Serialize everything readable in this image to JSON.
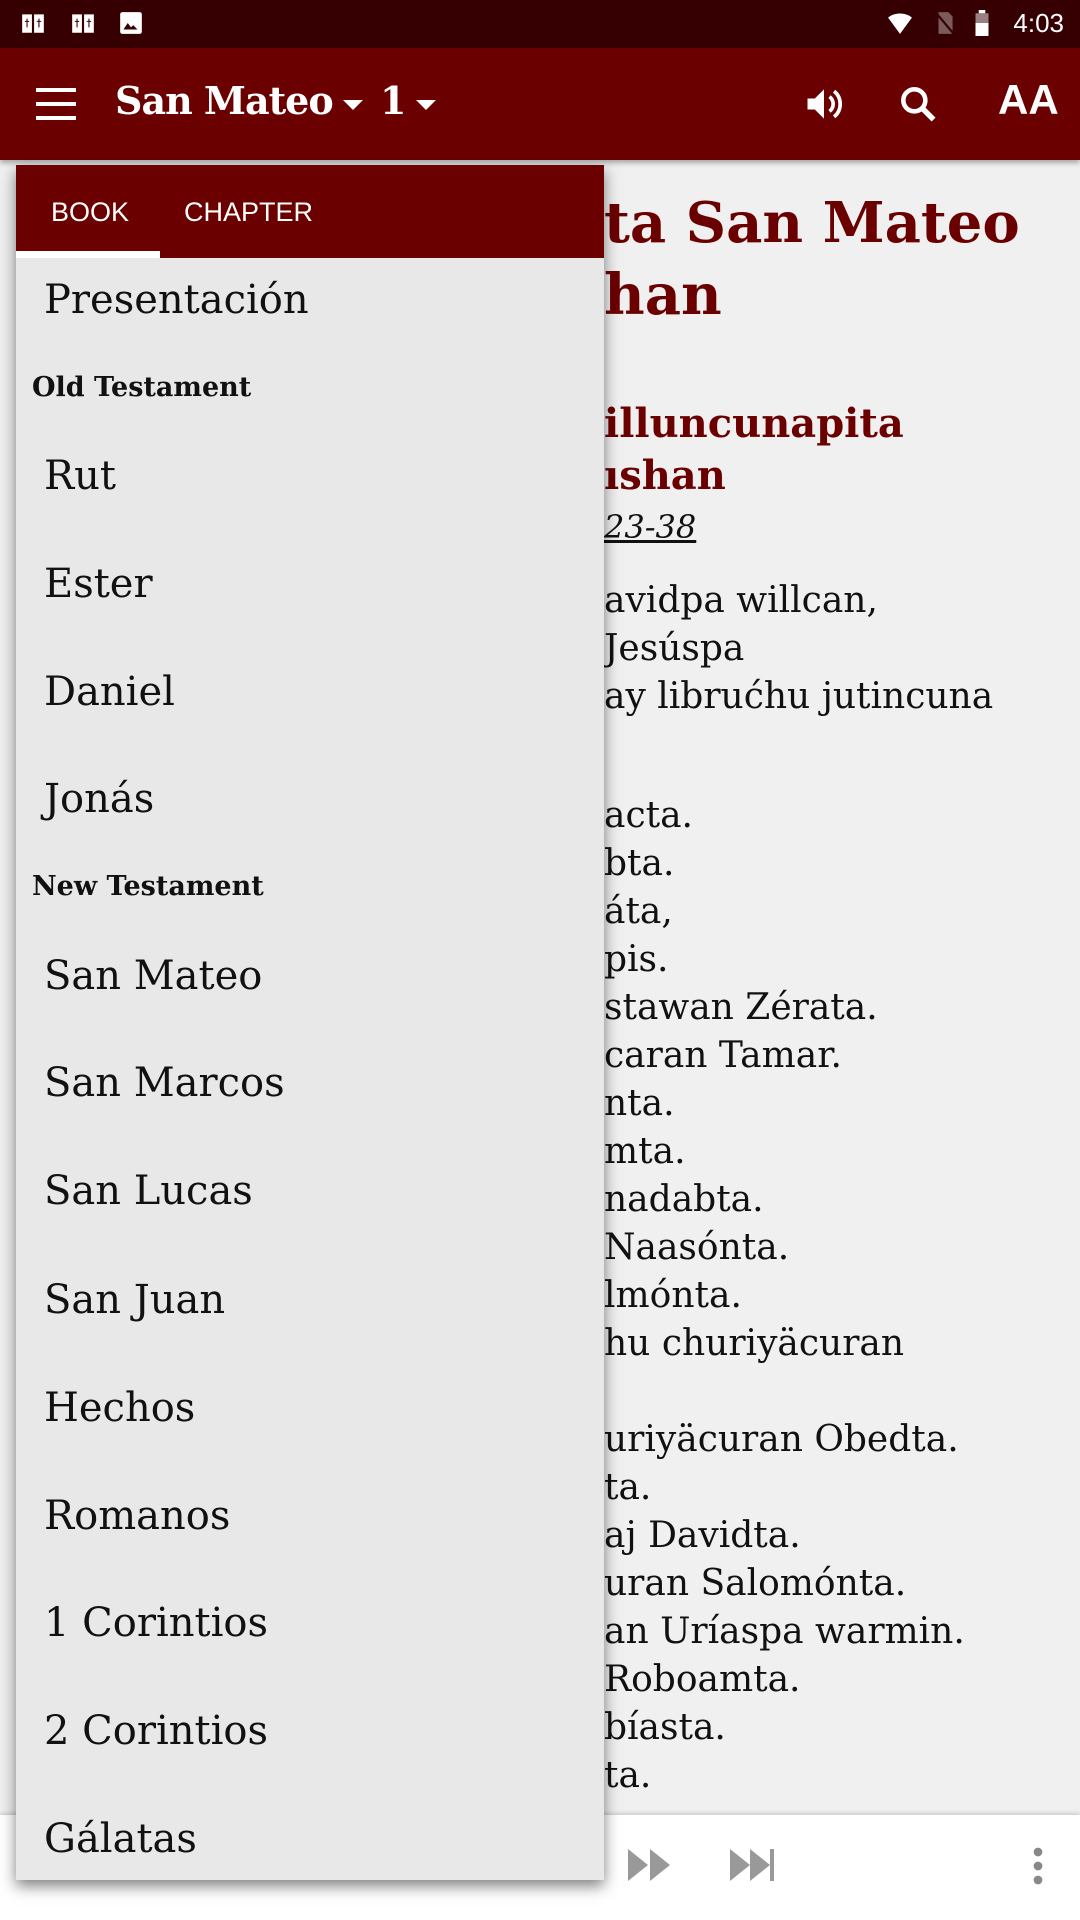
{
  "status_bar": {
    "time": "4:03",
    "icons": [
      "bible-icon",
      "bible-icon",
      "image-icon",
      "wifi-icon",
      "no-sim-icon",
      "battery-icon"
    ]
  },
  "app_bar": {
    "book": "San Mateo",
    "chapter": "1",
    "icons": [
      "menu-icon",
      "speaker-icon",
      "search-icon",
      "text-size-icon"
    ],
    "text_size_label": "AA"
  },
  "colors": {
    "primary": "#6b0001",
    "status": "#360003",
    "drawer_bg": "#e8e8e8"
  },
  "drawer": {
    "tabs": [
      {
        "label": "BOOK",
        "selected": true
      },
      {
        "label": "CHAPTER",
        "selected": false
      }
    ],
    "items": [
      {
        "type": "book",
        "label": "Presentación"
      },
      {
        "type": "section",
        "label": "Old Testament"
      },
      {
        "type": "book",
        "label": "Rut"
      },
      {
        "type": "book",
        "label": "Ester"
      },
      {
        "type": "book",
        "label": "Daniel"
      },
      {
        "type": "book",
        "label": "Jonás"
      },
      {
        "type": "section",
        "label": "New Testament"
      },
      {
        "type": "book",
        "label": "San Mateo"
      },
      {
        "type": "book",
        "label": "San Marcos"
      },
      {
        "type": "book",
        "label": "San Lucas"
      },
      {
        "type": "book",
        "label": "San Juan"
      },
      {
        "type": "book",
        "label": "Hechos"
      },
      {
        "type": "book",
        "label": "Romanos"
      },
      {
        "type": "book",
        "label": "1 Corintios"
      },
      {
        "type": "book",
        "label": "2 Corintios"
      },
      {
        "type": "book",
        "label": "Gálatas"
      }
    ]
  },
  "content": {
    "title": [
      "ta San Mateo",
      "han"
    ],
    "heading": [
      "illuncunapita",
      "ıshan"
    ],
    "reference": "23-38",
    "intro": [
      "avidpa willcan,",
      "Jesúspa",
      "ay librućhu jutincuna"
    ],
    "lines": [
      "acta.",
      "bta.",
      "áta,",
      "pis.",
      "stawan Zérata.",
      "caran Tamar.",
      "nta.",
      "mta.",
      "nadabta.",
      " Naasónta.",
      "lmónta.",
      "hu churiyäcuran",
      "",
      "uriyäcuran Obedta.",
      "ta.",
      "aj Davidta.",
      "uran Salomónta.",
      "an Uríaspa warmin.",
      "Roboamta.",
      "bíasta.",
      "ta."
    ]
  },
  "player": {
    "icons": [
      "fast-forward-icon",
      "skip-next-icon",
      "more-vert-icon"
    ]
  }
}
